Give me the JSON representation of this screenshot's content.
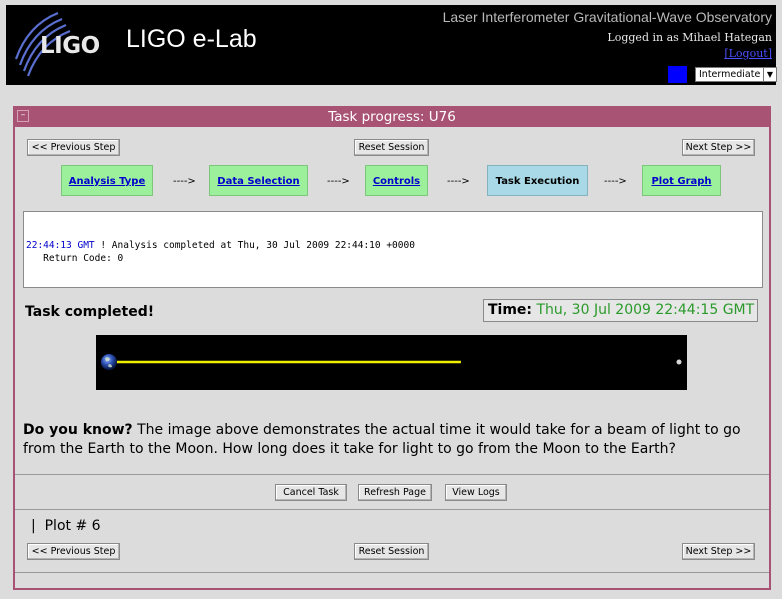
{
  "header": {
    "logo_text": "LIGO",
    "app_title": "LIGO e-Lab",
    "org_title": "Laser Interferometer Gravitational-Wave Observatory",
    "logged_in": "Logged in as Mihael Hategan",
    "logout": "[Logout]",
    "level_color": "#0000ff",
    "level": "Intermediate"
  },
  "panel": {
    "title": "Task progress: U76",
    "nav_top": {
      "prev": "<< Previous Step",
      "reset": "Reset Session",
      "next": "Next Step >>"
    },
    "steps": [
      {
        "label": "Analysis Type",
        "state": "done"
      },
      {
        "label": "Data Selection",
        "state": "done"
      },
      {
        "label": "Controls",
        "state": "done"
      },
      {
        "label": "Task Execution",
        "state": "current"
      },
      {
        "label": "Plot Graph",
        "state": "done"
      }
    ],
    "arrow": "---->",
    "log": {
      "time": "22:44:13 GMT",
      "message": " ! Analysis completed at Thu, 30 Jul 2009 22:44:10 +0000",
      "return_code": "   Return Code: 0"
    },
    "task_completed": "Task completed!",
    "time_label": "Time:",
    "time_value": "Thu, 30 Jul 2009 22:44:15 GMT",
    "beam_progress": 0.62,
    "do_you_know_label": "Do you know?",
    "do_you_know_text": " The image above demonstrates the actual time it would take for a beam of light to go from the Earth to the Moon. How long does it take for light to go from the Moon to the Earth?",
    "actions": {
      "cancel": "Cancel Task",
      "refresh": "Refresh Page",
      "logs": "View Logs"
    },
    "plot_label": "|  Plot # 6",
    "nav_bottom": {
      "prev": "<< Previous Step",
      "reset": "Reset Session",
      "next": "Next Step >>"
    }
  }
}
